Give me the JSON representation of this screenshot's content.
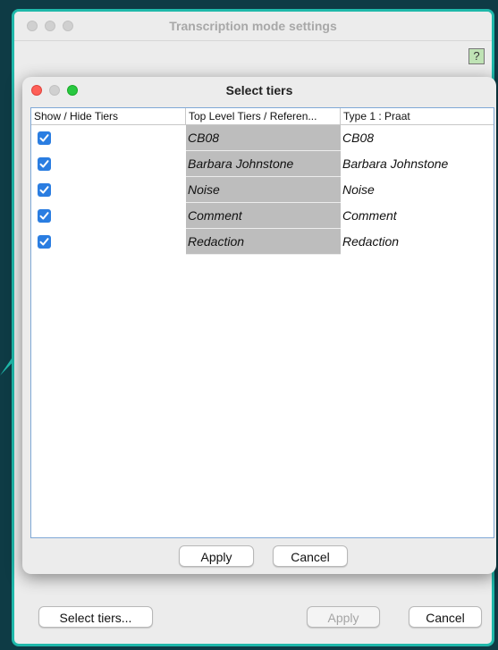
{
  "back_window": {
    "title": "Transcription mode settings",
    "help_label": "?",
    "buttons": {
      "select_tiers": "Select tiers...",
      "apply": "Apply",
      "cancel": "Cancel"
    }
  },
  "dialog": {
    "title": "Select tiers",
    "columns": [
      "Show / Hide Tiers",
      "Top Level Tiers / Referen...",
      "Type 1 : Praat"
    ],
    "rows": [
      {
        "checked": true,
        "tier": "CB08",
        "type": "CB08"
      },
      {
        "checked": true,
        "tier": "Barbara Johnstone",
        "type": "Barbara Johnstone"
      },
      {
        "checked": true,
        "tier": "Noise",
        "type": "Noise"
      },
      {
        "checked": true,
        "tier": "Comment",
        "type": "Comment"
      },
      {
        "checked": true,
        "tier": "Redaction",
        "type": "Redaction"
      }
    ],
    "buttons": {
      "apply": "Apply",
      "cancel": "Cancel"
    }
  },
  "colors": {
    "background": "#0e3b45",
    "window_border": "#1fb8aa",
    "checkbox": "#2a7de1",
    "tier_cell": "#bdbdbd"
  }
}
